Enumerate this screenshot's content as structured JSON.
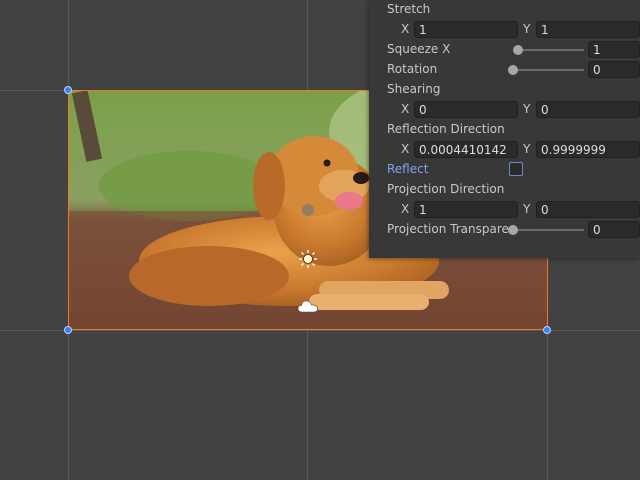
{
  "inspector": {
    "stretch": {
      "label": "Stretch",
      "x_axis": "X",
      "x": "1",
      "y_axis": "Y",
      "y": "1"
    },
    "squeeze_x": {
      "label": "Squeeze X",
      "value": "1",
      "slider_fraction": 0.05
    },
    "rotation": {
      "label": "Rotation",
      "value": "0",
      "slider_fraction": 0.0
    },
    "shearing": {
      "label": "Shearing",
      "x_axis": "X",
      "x": "0",
      "y_axis": "Y",
      "y": "0"
    },
    "reflection_direction": {
      "label": "Reflection Direction",
      "x_axis": "X",
      "x": "0.0004410142",
      "y_axis": "Y",
      "y": "0.9999999"
    },
    "reflect": {
      "label": "Reflect",
      "checked": false
    },
    "projection_direction": {
      "label": "Projection Direction",
      "x_axis": "X",
      "x": "1",
      "y_axis": "Y",
      "y": "0"
    },
    "projection_transparency": {
      "label": "Projection Transparency",
      "value": "0",
      "slider_fraction": 0.0
    }
  },
  "scene": {
    "image_subject": "golden-retriever-photo",
    "selection_color": "#f07a1a",
    "handle_color": "#3a7ff0",
    "icons": [
      "sun-icon",
      "cloud-icon",
      "pivot-handle"
    ]
  }
}
